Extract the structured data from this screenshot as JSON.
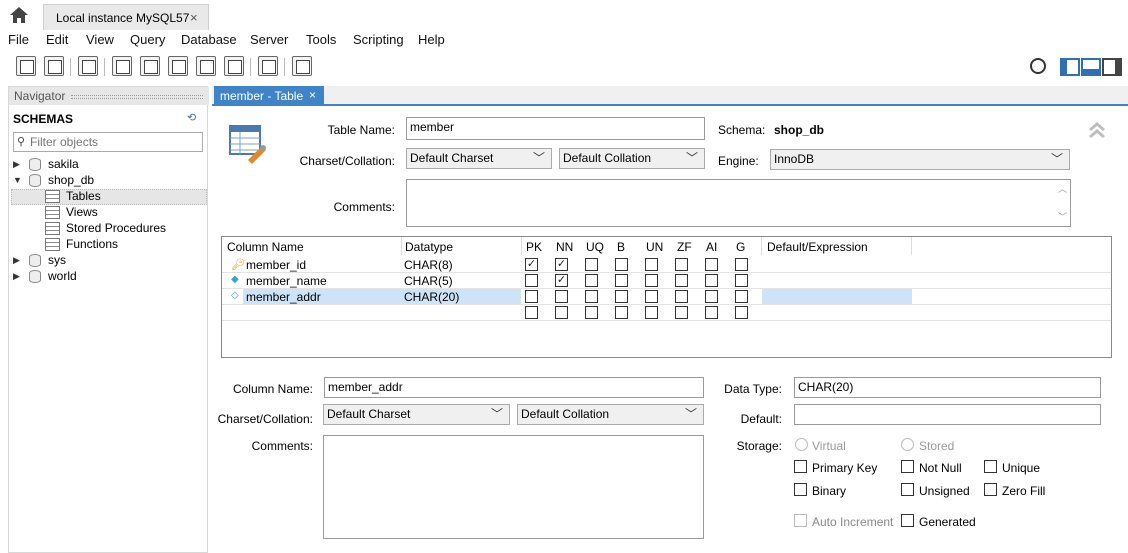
{
  "connection_tab": {
    "title": "Local instance MySQL57",
    "close": "×"
  },
  "menu": [
    "File",
    "Edit",
    "View",
    "Query",
    "Database",
    "Server",
    "Tools",
    "Scripting",
    "Help"
  ],
  "navigator": {
    "header": "Navigator",
    "schemas_title": "SCHEMAS",
    "filter_placeholder": "Filter objects",
    "tree": [
      {
        "label": "sakila"
      },
      {
        "label": "shop_db"
      },
      {
        "label": "Tables"
      },
      {
        "label": "Views"
      },
      {
        "label": "Stored Procedures"
      },
      {
        "label": "Functions"
      },
      {
        "label": "sys"
      },
      {
        "label": "world"
      }
    ]
  },
  "editor_tab": {
    "label": "member - Table",
    "close": "×"
  },
  "table_form": {
    "table_name_label": "Table Name:",
    "table_name": "member",
    "schema_label": "Schema:",
    "schema": "shop_db",
    "charset_label": "Charset/Collation:",
    "charset": "Default Charset",
    "collation": "Default Collation",
    "engine_label": "Engine:",
    "engine": "InnoDB",
    "comments_label": "Comments:"
  },
  "columns_grid": {
    "headers": [
      "Column Name",
      "Datatype",
      "PK",
      "NN",
      "UQ",
      "B",
      "UN",
      "ZF",
      "AI",
      "G",
      "Default/Expression"
    ],
    "rows": [
      {
        "name": "member_id",
        "datatype": "CHAR(8)",
        "flags": [
          true,
          true,
          false,
          false,
          false,
          false,
          false,
          false
        ],
        "key": true
      },
      {
        "name": "member_name",
        "datatype": "CHAR(5)",
        "flags": [
          false,
          true,
          false,
          false,
          false,
          false,
          false,
          false
        ],
        "key": false
      },
      {
        "name": "member_addr",
        "datatype": "CHAR(20)",
        "flags": [
          false,
          false,
          false,
          false,
          false,
          false,
          false,
          false
        ],
        "key": false
      },
      {
        "name": "",
        "datatype": "",
        "flags": [
          false,
          false,
          false,
          false,
          false,
          false,
          false,
          false
        ],
        "key": false
      }
    ]
  },
  "column_details": {
    "column_name_label": "Column Name:",
    "column_name": "member_addr",
    "data_type_label": "Data Type:",
    "data_type": "CHAR(20)",
    "charset_label": "Charset/Collation:",
    "charset": "Default Charset",
    "collation": "Default Collation",
    "default_label": "Default:",
    "default": "",
    "comments_label": "Comments:",
    "storage_label": "Storage:",
    "virtual": "Virtual",
    "stored": "Stored",
    "primary_key": "Primary Key",
    "not_null": "Not Null",
    "unique": "Unique",
    "binary": "Binary",
    "unsigned": "Unsigned",
    "zero_fill": "Zero Fill",
    "auto_increment": "Auto Increment",
    "generated": "Generated"
  },
  "colors": {
    "accent": "#3f84c6",
    "selected_row": "#cde3f7"
  }
}
